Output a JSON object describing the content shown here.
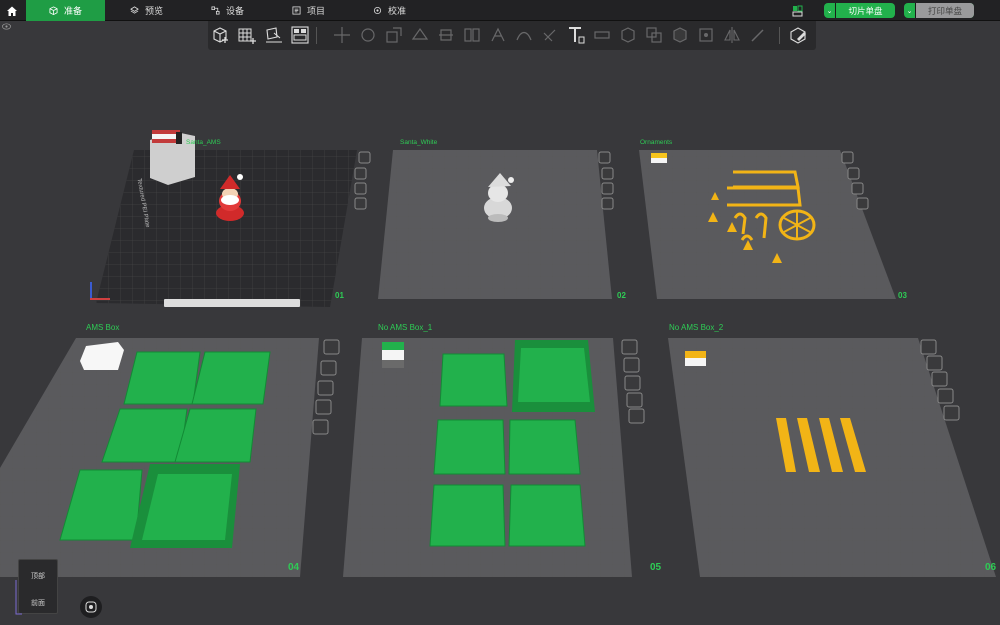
{
  "topbar": {
    "tabs": [
      {
        "label": "准备",
        "icon": "cube-icon",
        "active": true
      },
      {
        "label": "预览",
        "icon": "layers-icon",
        "active": false
      },
      {
        "label": "设备",
        "icon": "device-icon",
        "active": false
      },
      {
        "label": "项目",
        "icon": "project-icon",
        "active": false
      },
      {
        "label": "校准",
        "icon": "calibrate-icon",
        "active": false
      }
    ],
    "slice_plate_label": "切片单盘",
    "print_plate_label": "打印单盘"
  },
  "plates": [
    {
      "label": "Santa_AMS",
      "number": "01"
    },
    {
      "label": "Santa_White",
      "number": "02"
    },
    {
      "label": "Ornaments",
      "number": "03"
    },
    {
      "label": "AMS Box",
      "number": "04"
    },
    {
      "label": "No AMS Box_1",
      "number": "05"
    },
    {
      "label": "No AMS Box_2",
      "number": "06"
    }
  ],
  "plate1_side_text": "Textured PEI Plate",
  "navcube": {
    "top_label": "顶部",
    "front_label": "前面"
  },
  "colors": {
    "accent": "#22b14c",
    "plate": "#4a4a4d",
    "model_green": "#22b14c",
    "model_yellow": "#f2b416"
  }
}
